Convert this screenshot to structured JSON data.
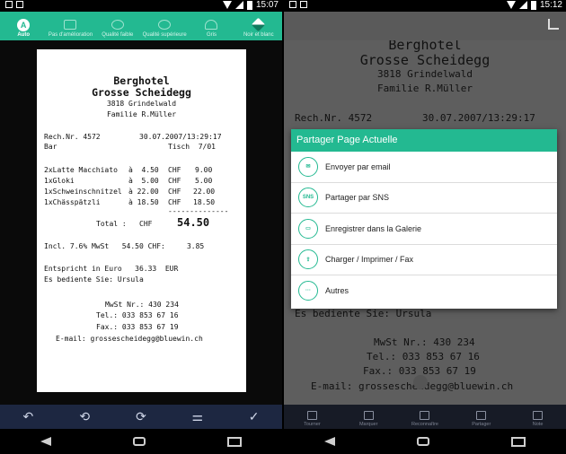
{
  "left": {
    "status": {
      "time": "15:07"
    },
    "filters": [
      {
        "label": "Auto",
        "icon": "auto-icon",
        "glyph": "A"
      },
      {
        "label": "Pas d'amélioration",
        "icon": "no-enhance-icon"
      },
      {
        "label": "Qualité faible",
        "icon": "low-quality-icon"
      },
      {
        "label": "Qualité supérieure",
        "icon": "high-quality-icon"
      },
      {
        "label": "Gris",
        "icon": "gray-icon"
      },
      {
        "label": "Noir et blanc",
        "icon": "bw-icon"
      }
    ],
    "toolbar": [
      "↶",
      "⟲",
      "⟳",
      "⚌",
      "✓"
    ],
    "receipt": {
      "name1": "Berghotel",
      "name2": "Grosse Scheidegg",
      "addr": "3818 Grindelwald",
      "owner": "Familie R.Müller",
      "rech": "Rech.Nr. 4572",
      "datetime": "30.07.2007/13:29:17",
      "bar": "Bar",
      "tisch": "Tisch  7/01",
      "items": [
        {
          "name": "2xLatte Macchiato",
          "price": "à  4.50",
          "cur": "CHF",
          "total": "9.00"
        },
        {
          "name": "1xGloki",
          "price": "à  5.00",
          "cur": "CHF",
          "total": "5.00"
        },
        {
          "name": "1xSchweinschnitzel",
          "price": "à 22.00",
          "cur": "CHF",
          "total": "22.00"
        },
        {
          "name": "1xChässpätzli",
          "price": "à 18.50",
          "cur": "CHF",
          "total": "18.50"
        }
      ],
      "dashes": "--------------",
      "total_label": "Total :",
      "total_cur": "CHF",
      "total": "54.50",
      "incl": "Incl. 7.6% MwSt   54.50 CHF:     3.85",
      "euro": "Entspricht in Euro   36.33  EUR",
      "bediente": "Es bediente Sie: Ursula",
      "mwst": "MwSt Nr.: 430 234",
      "tel": "Tel.: 033 853 67 16",
      "fax": "Fax.: 033 853 67 19",
      "email": "E-mail: grossescheidegg@bluewin.ch"
    }
  },
  "right": {
    "status": {
      "time": "15:12"
    },
    "dialog": {
      "title": "Partager Page Actuelle",
      "items": [
        {
          "label": "Envoyer par email",
          "icon": "email-icon"
        },
        {
          "label": "Partager par SNS",
          "icon": "sns-icon",
          "glyph": "SNS"
        },
        {
          "label": "Enregistrer dans la Galerie",
          "icon": "gallery-icon"
        },
        {
          "label": "Charger / Imprimer / Fax",
          "icon": "upload-icon"
        },
        {
          "label": "Autres",
          "icon": "more-icon",
          "glyph": "···"
        }
      ]
    },
    "toolbar": [
      {
        "label": "Tourner",
        "icon": "rotate-icon"
      },
      {
        "label": "Marquer",
        "icon": "mark-icon"
      },
      {
        "label": "Reconnaître",
        "icon": "recognize-icon"
      },
      {
        "label": "Partager",
        "icon": "share-icon"
      },
      {
        "label": "Note",
        "icon": "note-icon"
      }
    ],
    "doc": {
      "name1": "Berghotel",
      "name2": "Grosse Scheidegg",
      "addr": "3818 Grindelwald",
      "owner": "Familie R.Müller",
      "rech": "Rech.Nr. 4572",
      "datetime": "30.07.2007/13:29:17",
      "bediente": "Es bediente Sie: Ursula",
      "mwst": "MwSt Nr.: 430 234",
      "tel": "Tel.: 033 853 67 16",
      "fax": "Fax.: 033 853 67 19",
      "email": "E-mail: grossescheidegg@bluewin.ch"
    }
  }
}
